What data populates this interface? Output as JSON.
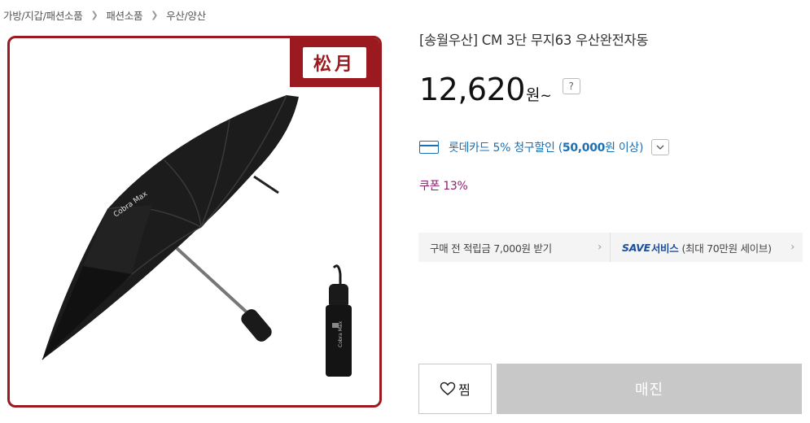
{
  "breadcrumb": [
    "가방/지갑/패션소품",
    "패션소품",
    "우산/양산"
  ],
  "product": {
    "title": "[송월우산] CM 3단 무지63 우산완전자동",
    "brand_logo_text": "松月",
    "umbrella_print": "Cobra Max"
  },
  "price": {
    "value": "12,620",
    "unit": "원",
    "suffix": "~",
    "help_label": "?"
  },
  "card_discount": {
    "prefix": "롯데카드 5% 청구할인 (",
    "amount": "50,000",
    "suffix": "원 이상)",
    "icon": "credit-card-icon",
    "toggle_icon": "chevron-down-icon"
  },
  "coupon": {
    "label": "쿠폰 13%"
  },
  "benefits": {
    "points_label": "구매 전 적립금 7,000원 받기",
    "save_word": "SAVE",
    "save_suffix": "서비스",
    "save_detail": "(최대 70만원 세이브)"
  },
  "actions": {
    "wish_label": "찜",
    "soldout_label": "매진"
  },
  "colors": {
    "brand_red": "#9a1a1f",
    "card_blue": "#1b6fb2",
    "coupon_purple": "#8e1d6d",
    "save_blue": "#1b4f9b",
    "disabled_gray": "#c8c8c8"
  }
}
